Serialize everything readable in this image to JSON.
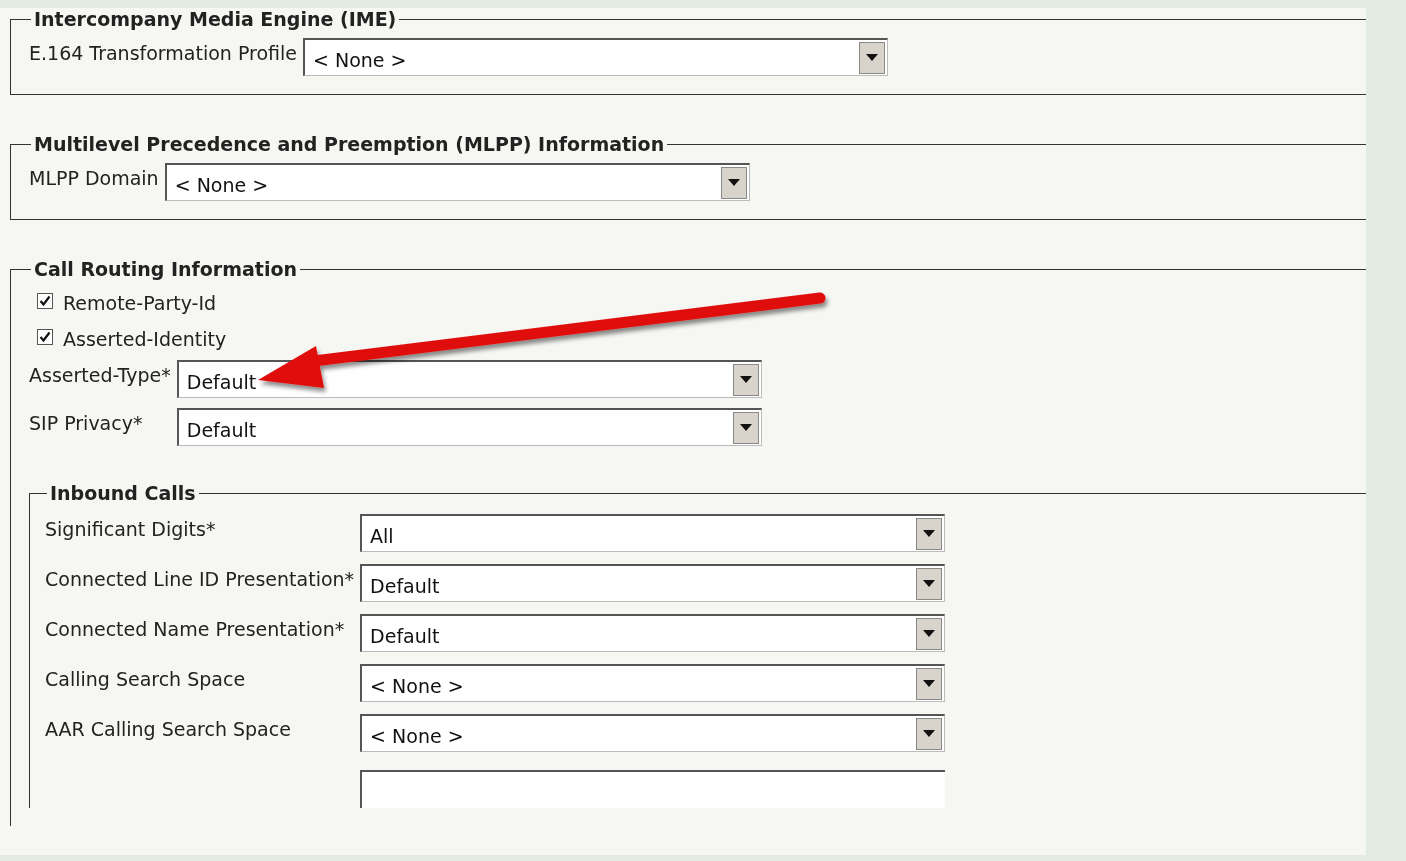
{
  "sections": [
    {
      "legend": "Intercompany Media Engine (IME)",
      "fields": [
        {
          "kind": "select",
          "label": "E.164 Transformation Profile",
          "value": "< None >"
        }
      ]
    },
    {
      "legend": "Multilevel Precedence and Preemption (MLPP) Information",
      "fields": [
        {
          "kind": "select",
          "label": "MLPP Domain",
          "value": "< None >"
        }
      ]
    },
    {
      "legend": "Call Routing Information",
      "fields": [
        {
          "kind": "checkbox",
          "label": "Remote-Party-Id",
          "checked": true
        },
        {
          "kind": "checkbox",
          "label": "Asserted-Identity",
          "checked": true
        },
        {
          "kind": "select",
          "label": "Asserted-Type*",
          "value": "Default"
        },
        {
          "kind": "select",
          "label": "SIP Privacy*",
          "value": "Default"
        }
      ],
      "subsections": [
        {
          "legend": "Inbound Calls",
          "fields": [
            {
              "kind": "select",
              "label": "Significant Digits*",
              "value": "All"
            },
            {
              "kind": "select",
              "label": "Connected Line ID Presentation*",
              "value": "Default"
            },
            {
              "kind": "select",
              "label": "Connected Name Presentation*",
              "value": "Default"
            },
            {
              "kind": "select",
              "label": "Calling Search Space",
              "value": "< None >"
            },
            {
              "kind": "select",
              "label": "AAR Calling Search Space",
              "value": "< None >"
            },
            {
              "kind": "text"
            }
          ]
        }
      ]
    }
  ]
}
